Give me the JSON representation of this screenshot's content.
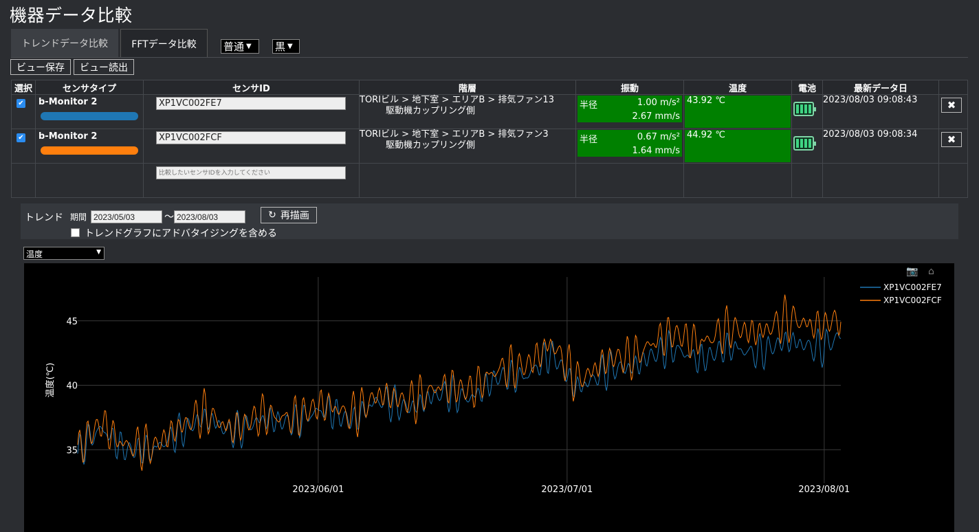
{
  "page": {
    "title": "機器データ比較"
  },
  "tabs": [
    {
      "label": "トレンドデータ比較"
    },
    {
      "label": "FFTデータ比較"
    }
  ],
  "selects": {
    "mode": "普通",
    "theme": "黒"
  },
  "view_buttons": {
    "save": "ビュー保存",
    "load": "ビュー読出"
  },
  "table": {
    "headers": [
      "選択",
      "センサタイプ",
      "センサID",
      "階層",
      "振動",
      "温度",
      "電池",
      "最新データ日"
    ],
    "rows": [
      {
        "checked": true,
        "type": "b-Monitor 2",
        "color": "#1f77b4",
        "sensor_id": "XP1VC002FE7",
        "location_line1": "TORIビル > 地下室 > エリアB > 排気ファン13",
        "location_line2": "駆動機カップリング側",
        "vib_label": "半径",
        "vib_acc": "1.00 m/s²",
        "vib_vel": "2.67 mm/s",
        "temp": "43.92 ℃",
        "battery": "full",
        "latest": "2023/08/03 09:08:43"
      },
      {
        "checked": true,
        "type": "b-Monitor 2",
        "color": "#ff7f0e",
        "sensor_id": "XP1VC002FCF",
        "location_line1": "TORIビル > 地下室 > エリアB > 排気ファン3",
        "location_line2": "駆動機カップリング側",
        "vib_label": "半径",
        "vib_acc": "0.67 m/s²",
        "vib_vel": "1.64 mm/s",
        "temp": "44.92 ℃",
        "battery": "full",
        "latest": "2023/08/03 09:08:34"
      }
    ],
    "new_row_placeholder": "比較したいセンサIDを入力してください"
  },
  "trend": {
    "label": "トレンド",
    "period_label": "期間",
    "from": "2023/05/03",
    "to": "2023/08/03",
    "tilde": "～",
    "redraw": "再描画",
    "checkbox_label": "トレンドグラフにアドバタイジングを含める",
    "metric": "温度"
  },
  "chart_data": {
    "type": "line",
    "ylabel": "温度(℃)",
    "xlabel": "",
    "x_range": [
      "2023-05-03",
      "2023-08-03"
    ],
    "ylim": [
      32.4,
      48.4
    ],
    "yticks": [
      35,
      40,
      45
    ],
    "xticks": [
      "2023/06/01",
      "2023/07/01",
      "2023/08/01"
    ],
    "grid": true,
    "legend": "top-right",
    "series": [
      {
        "name": "XP1VC002FE7",
        "color": "#1f77b4",
        "days": [
          0,
          3,
          6,
          9,
          12,
          15,
          18,
          21,
          24,
          27,
          30,
          33,
          36,
          39,
          42,
          45,
          48,
          51,
          54,
          57,
          60,
          63,
          66,
          69,
          72,
          75,
          78,
          81,
          84,
          87,
          90,
          92
        ],
        "trend": [
          34.7,
          36.5,
          35.2,
          34.6,
          36.6,
          37.2,
          36.6,
          37.0,
          37.1,
          37.6,
          37.8,
          37.6,
          38.5,
          38.5,
          38.8,
          39.2,
          39.4,
          40.4,
          41.0,
          42.2,
          40.0,
          40.9,
          41.2,
          42.5,
          42.5,
          42.3,
          42.6,
          42.7,
          43.0,
          43.2,
          43.2,
          43.6
        ],
        "amp": 1.2
      },
      {
        "name": "XP1VC002FCF",
        "color": "#ff7f0e",
        "days": [
          0,
          3,
          6,
          9,
          12,
          15,
          18,
          21,
          24,
          27,
          30,
          33,
          36,
          39,
          42,
          45,
          48,
          51,
          54,
          57,
          60,
          63,
          66,
          69,
          72,
          75,
          78,
          81,
          84,
          87,
          90,
          92
        ],
        "trend": [
          34.9,
          36.9,
          35.5,
          34.8,
          37.0,
          37.6,
          36.8,
          37.3,
          37.4,
          38.0,
          38.2,
          38.0,
          38.9,
          39.0,
          39.3,
          39.8,
          40.0,
          41.0,
          41.8,
          43.0,
          40.6,
          41.6,
          42.0,
          43.4,
          43.7,
          43.6,
          44.0,
          44.3,
          44.6,
          44.9,
          44.9,
          44.9
        ],
        "amp": 1.5
      }
    ]
  }
}
